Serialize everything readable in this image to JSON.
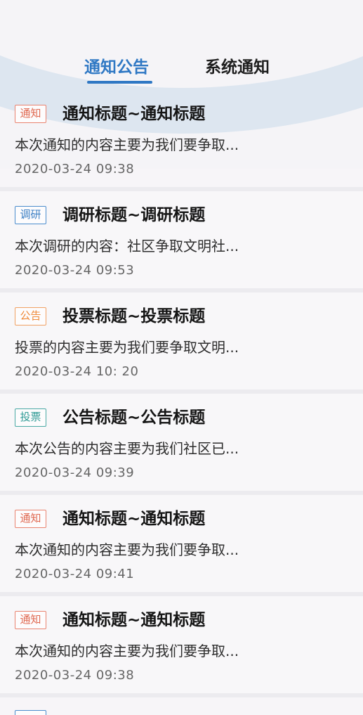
{
  "tabs": [
    {
      "label": "通知公告",
      "active": true
    },
    {
      "label": "系统通知",
      "active": false
    }
  ],
  "colors": {
    "accent": "#2f78c4",
    "tag_notice": "#e06a52",
    "tag_survey": "#3b7fc4",
    "tag_announce": "#ef8a3a",
    "tag_vote": "#2f9a95"
  },
  "items": [
    {
      "tag": "通知",
      "tag_color": "red",
      "title": "通知标题~通知标题",
      "summary": "本次通知的内容主要为我们要争取...",
      "time": "2020-03-24  09:38"
    },
    {
      "tag": "调研",
      "tag_color": "blue",
      "title": "调研标题~调研标题",
      "summary": "本次调研的内容：社区争取文明社...",
      "time": "2020-03-24  09:53"
    },
    {
      "tag": "公告",
      "tag_color": "orange",
      "title": "投票标题~投票标题",
      "summary": "投票的内容主要为我们要争取文明...",
      "time": "2020-03-24  10: 20"
    },
    {
      "tag": "投票",
      "tag_color": "teal",
      "title": "公告标题~公告标题",
      "summary": "本次公告的内容主要为我们社区已...",
      "time": "2020-03-24  09:39"
    },
    {
      "tag": "通知",
      "tag_color": "red",
      "title": "通知标题~通知标题",
      "summary": "本次通知的内容主要为我们要争取...",
      "time": "2020-03-24  09:41"
    },
    {
      "tag": "通知",
      "tag_color": "red",
      "title": "通知标题~通知标题",
      "summary": "本次通知的内容主要为我们要争取...",
      "time": "2020-03-24  09:38"
    }
  ]
}
